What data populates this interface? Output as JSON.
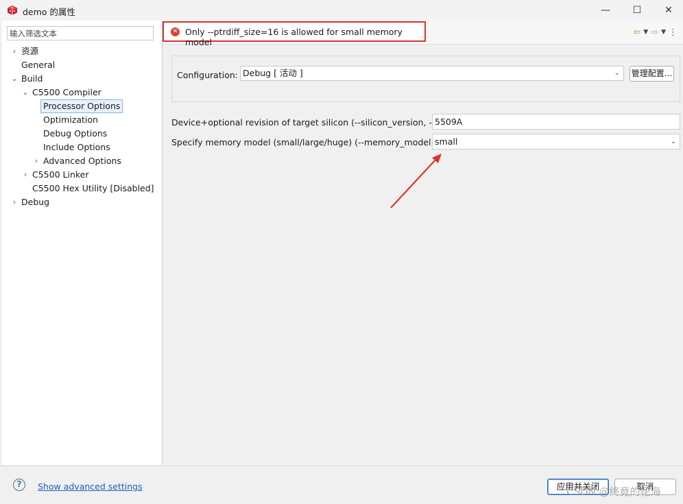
{
  "window": {
    "title": "demo 的属性",
    "minimize_glyph": "—",
    "maximize_glyph": "☐",
    "close_glyph": "✕"
  },
  "filter": {
    "placeholder": "输入筛选文本"
  },
  "tree": {
    "resources": "资源",
    "general": "General",
    "build": "Build",
    "compiler": "C5500 Compiler",
    "processor_options": "Processor Options",
    "optimization": "Optimization",
    "debug_options": "Debug Options",
    "include_options": "Include Options",
    "advanced_options": "Advanced Options",
    "linker": "C5500 Linker",
    "hex_utility": "C5500 Hex Utility  [Disabled]",
    "debug": "Debug"
  },
  "error": {
    "message": "Only --ptrdiff_size=16 is allowed for small memory model",
    "icon_glyph": "✕"
  },
  "configuration": {
    "label": "Configuration:",
    "value": "Debug  [ 活动 ]",
    "manage_button": "管理配置..."
  },
  "fields": {
    "silicon_label": "Device+optional revision of target silicon (--silicon_version, -v)",
    "silicon_value": "5509A",
    "memory_label": "Specify memory model (small/large/huge) (--memory_model)",
    "memory_value": "small"
  },
  "bottom": {
    "help_glyph": "?",
    "advanced_link": "Show advanced settings",
    "apply_close": "应用并关闭",
    "cancel": "取消"
  },
  "watermark": "CSDN @终竟的花海",
  "colors": {
    "error_border": "#e0302a",
    "annotation_arrow": "#e0302a",
    "link": "#1a5fb4",
    "selection_border": "#7eb4ea"
  }
}
